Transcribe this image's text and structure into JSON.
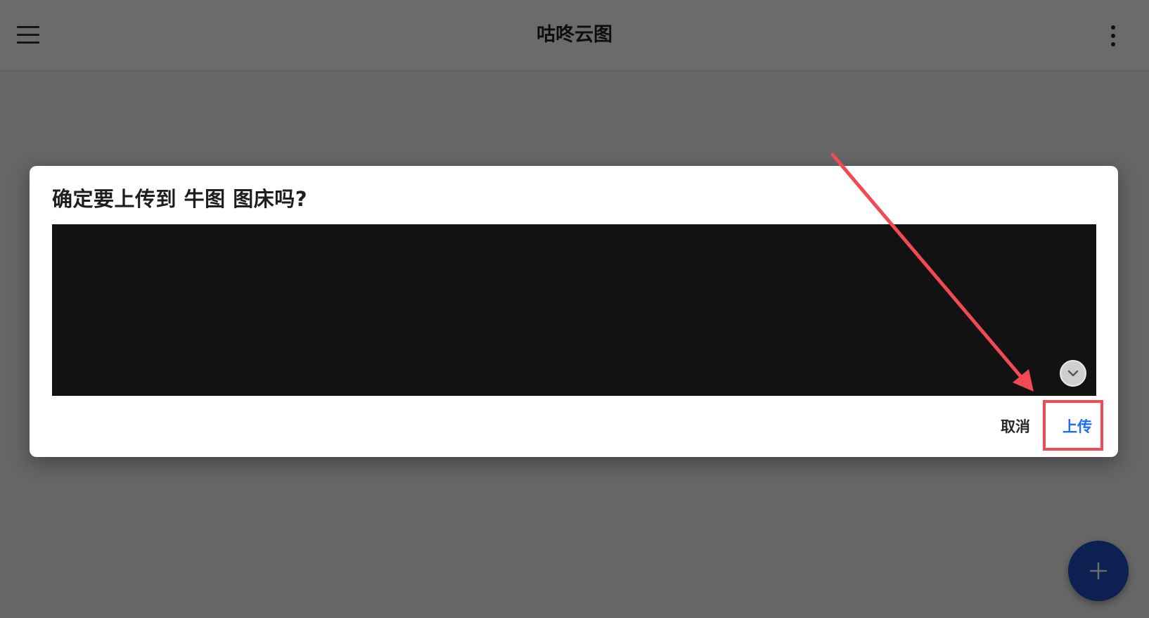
{
  "app_bar": {
    "title": "咕咚云图",
    "menu_icon": "hamburger-menu-icon",
    "more_icon": "more-vertical-icon"
  },
  "dialog": {
    "title": "确定要上传到 牛图 图床吗?",
    "expand_icon": "chevron-down-icon",
    "cancel_label": "取消",
    "upload_label": "上传"
  },
  "fab": {
    "icon": "plus-icon"
  },
  "colors": {
    "accent": "#1e6ff0",
    "fab": "#1d4fc4",
    "annotation": "#f14a52",
    "preview_bg": "#121212"
  }
}
